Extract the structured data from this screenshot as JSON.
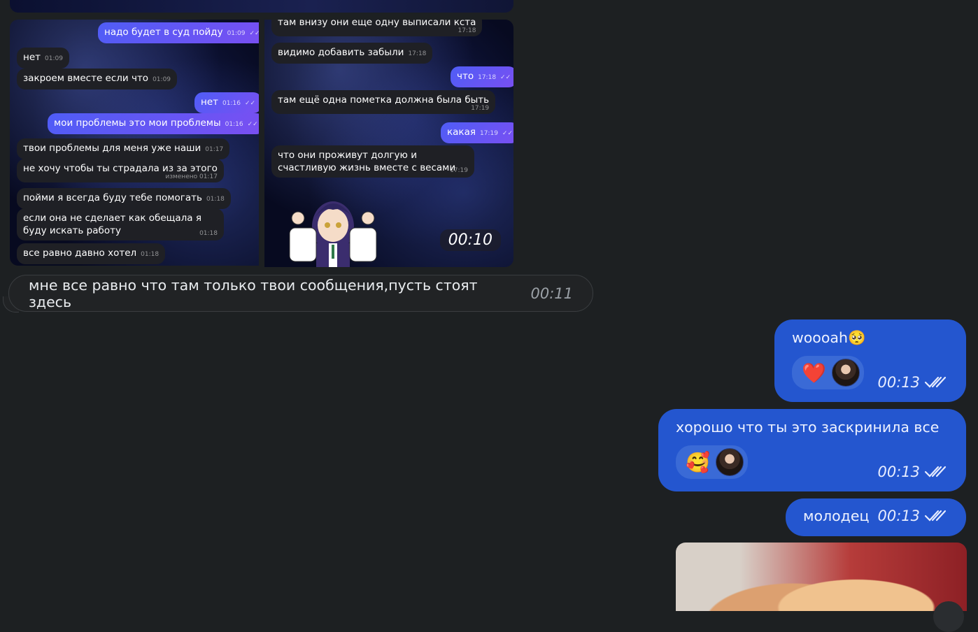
{
  "screenshot_left": {
    "messages": [
      {
        "dir": "out",
        "text": "надо будет в суд пойду",
        "time": "01:09"
      },
      {
        "dir": "in",
        "text": "нет",
        "time": "01:09"
      },
      {
        "dir": "in",
        "text": "закроем вместе если что",
        "time": "01:09"
      },
      {
        "dir": "out",
        "text": "нет",
        "time": "01:16"
      },
      {
        "dir": "out",
        "text": "мои проблемы это мои проблемы",
        "time": "01:16"
      },
      {
        "dir": "in",
        "text": "твои проблемы для меня уже наши",
        "time": "01:17"
      },
      {
        "dir": "in",
        "text": "не хочу чтобы ты страдала из за этого",
        "time": "изменено 01:17"
      },
      {
        "dir": "in",
        "text": "пойми я всегда буду тебе помогать",
        "time": "01:18"
      },
      {
        "dir": "in",
        "text": "если она не сделает как обещала я буду искать работу",
        "time": "01:18"
      },
      {
        "dir": "in",
        "text": "все равно давно хотел",
        "time": "01:18"
      }
    ]
  },
  "screenshot_right": {
    "messages": [
      {
        "dir": "in",
        "text": "там внизу они еще одну выписали кста",
        "time": "17:18"
      },
      {
        "dir": "in",
        "text": "видимо добавить забыли",
        "time": "17:18"
      },
      {
        "dir": "out",
        "text": "что",
        "time": "17:18"
      },
      {
        "dir": "in",
        "text": "там ещё одна пометка должна была быть",
        "time": "17:19"
      },
      {
        "dir": "out",
        "text": "какая",
        "time": "17:19"
      },
      {
        "dir": "in",
        "text": "что они проживут долгую и счастливую жизнь вместе с весами",
        "time": "17:19"
      }
    ],
    "video_duration": "00:10"
  },
  "incoming_message": {
    "text": "мне все равно что там только твои сообщения,пусть стоят здесь",
    "time": "00:11"
  },
  "outgoing_messages": [
    {
      "text": "woooah🥺",
      "time": "00:13",
      "reaction": "❤️"
    },
    {
      "text": "хорошо что ты это заскринила все",
      "time": "00:13",
      "reaction": "🥰"
    },
    {
      "text": "молодец",
      "time": "00:13"
    }
  ],
  "icons": {
    "read_receipt": "double-check-icon"
  }
}
